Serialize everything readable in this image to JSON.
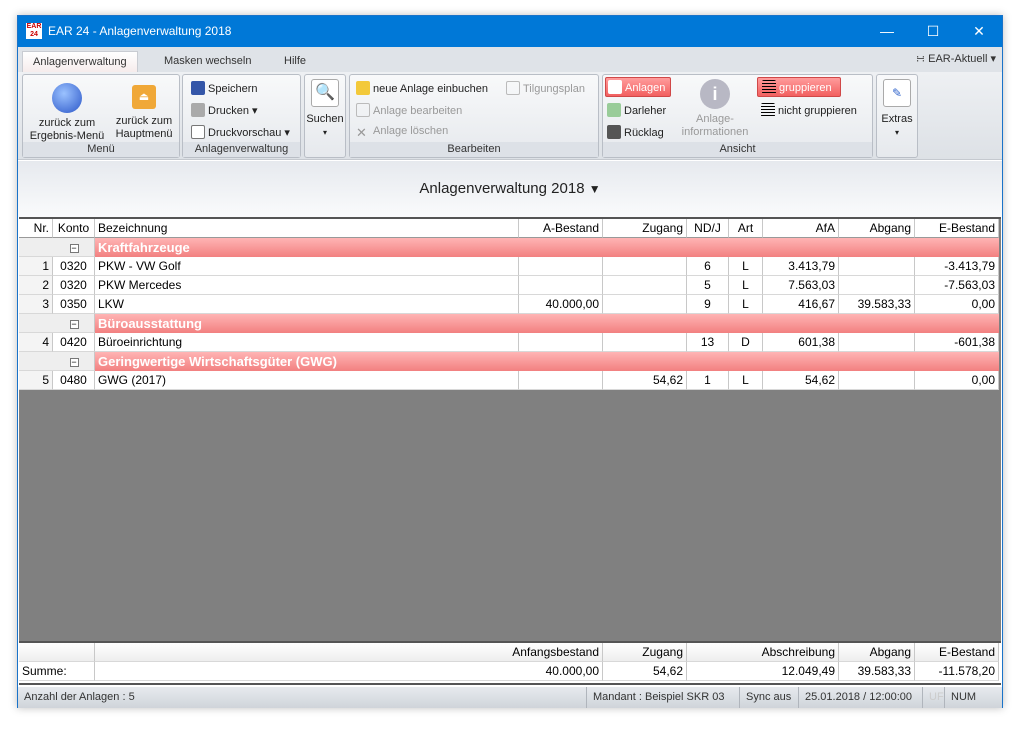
{
  "window": {
    "title": "EAR 24 - Anlagenverwaltung 2018",
    "logo": "EAR 24"
  },
  "tabs": [
    "Anlagenverwaltung",
    "Masken wechseln",
    "Hilfe"
  ],
  "ear_aktuell": "EAR-Aktuell",
  "ribbon": {
    "menu": {
      "label": "Menü",
      "btn1": "zurück zum Ergebnis-Menü",
      "btn2": "zurück zum Hauptmenü"
    },
    "verwaltung": {
      "label": "Anlagenverwaltung",
      "speichern": "Speichern",
      "drucken": "Drucken",
      "druckvorschau": "Druckvorschau"
    },
    "suchen": "Suchen",
    "bearbeiten": {
      "label": "Bearbeiten",
      "neu": "neue Anlage einbuchen",
      "tilgung": "Tilgungsplan",
      "bearb": "Anlage bearbeiten",
      "loeschen": "Anlage löschen"
    },
    "ansicht": {
      "label": "Ansicht",
      "anlagen": "Anlagen",
      "darlehen": "Darleher",
      "ruecklagen": "Rücklag",
      "info1": "Anlage-",
      "info2": "informationen",
      "grupp": "gruppieren",
      "nicht": "nicht gruppieren"
    },
    "extras": "Extras"
  },
  "heading": "Anlagenverwaltung 2018",
  "table": {
    "columns": [
      "Nr.",
      "Konto",
      "Bezeichnung",
      "A-Bestand",
      "Zugang",
      "ND/J",
      "Art",
      "AfA",
      "Abgang",
      "E-Bestand"
    ],
    "rows": [
      {
        "group": "Kraftfahrzeuge"
      },
      {
        "cells": [
          "1",
          "0320",
          "PKW - VW Golf",
          "",
          "",
          "6",
          "L",
          "3.413,79",
          "",
          "-3.413,79"
        ]
      },
      {
        "cells": [
          "2",
          "0320",
          "PKW Mercedes",
          "",
          "",
          "5",
          "L",
          "7.563,03",
          "",
          "-7.563,03"
        ]
      },
      {
        "cells": [
          "3",
          "0350",
          "LKW",
          "40.000,00",
          "",
          "9",
          "L",
          "416,67",
          "39.583,33",
          "0,00"
        ]
      },
      {
        "group": "Büroausstattung"
      },
      {
        "cells": [
          "4",
          "0420",
          "Büroeinrichtung",
          "",
          "",
          "13",
          "D",
          "601,38",
          "",
          "-601,38"
        ]
      },
      {
        "group": "Geringwertige Wirtschaftsgüter (GWG)"
      },
      {
        "cells": [
          "5",
          "0480",
          "GWG (2017)",
          "",
          "54,62",
          "1",
          "L",
          "54,62",
          "",
          "0,00"
        ]
      }
    ]
  },
  "footer": {
    "headers": [
      "",
      "Anfangsbestand",
      "Zugang",
      "Abschreibung",
      "Abgang",
      "E-Bestand"
    ],
    "values": [
      "Summe:",
      "40.000,00",
      "54,62",
      "12.049,49",
      "39.583,33",
      "-11.578,20"
    ]
  },
  "status": {
    "count": "Anzahl der Anlagen : 5",
    "mandant": "Mandant : Beispiel SKR 03",
    "sync": "Sync aus",
    "datetime": "25.01.2018 / 12:00:00",
    "uf": "UF",
    "num": "NUM"
  }
}
